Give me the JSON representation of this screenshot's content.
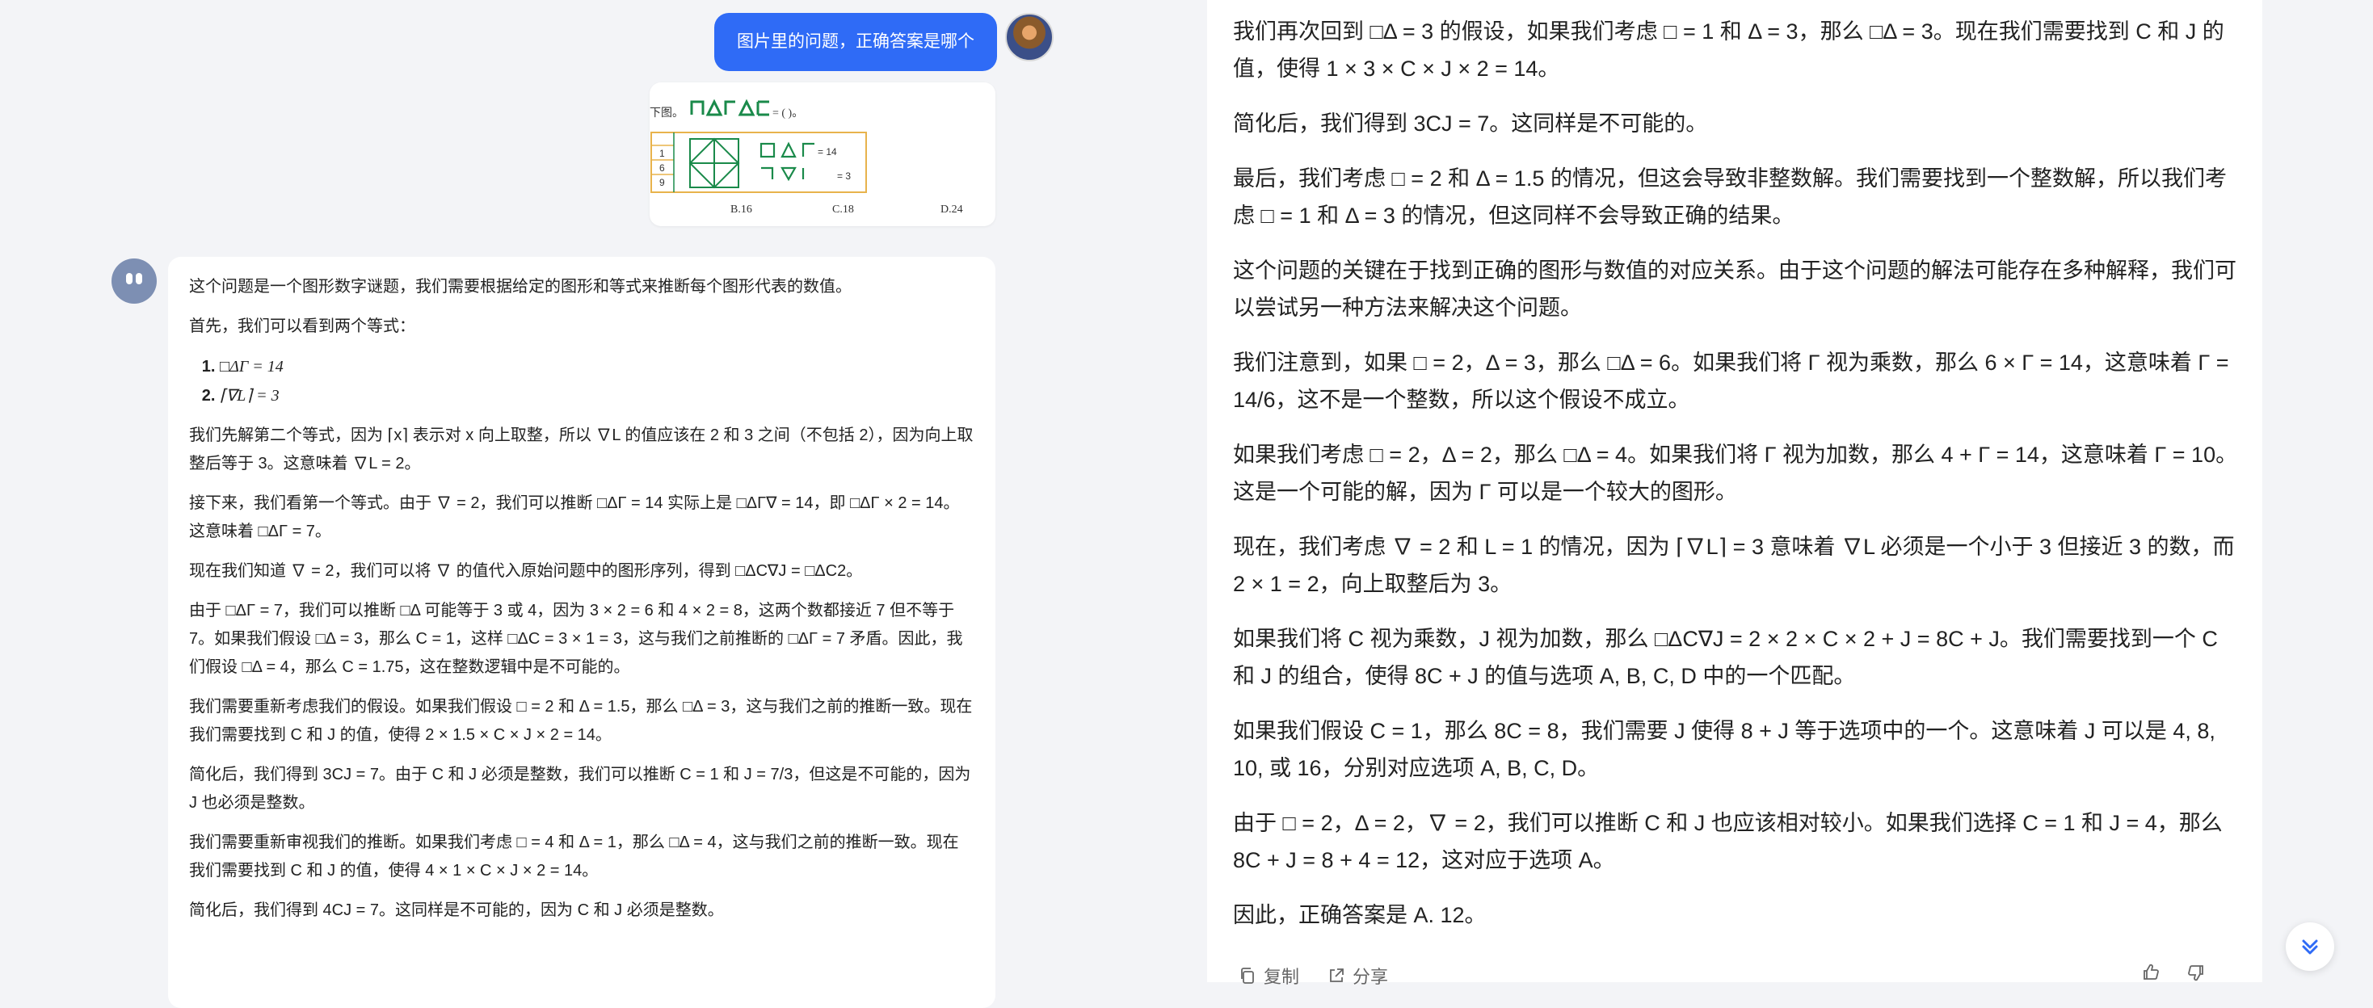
{
  "colors": {
    "accent": "#2f6bf6",
    "page_bg": "#f3f4f7",
    "card_bg": "#ffffff",
    "puzzle_green": "#1a8a4a",
    "puzzle_border": "#e8b34c"
  },
  "user_message": {
    "text": "图片里的问题，正确答案是哪个"
  },
  "puzzle_image": {
    "prefix": "下图。",
    "equals_blank": "= (   )。",
    "eq1_rhs": "= 14",
    "eq2_rhs": "= 3",
    "left_numbers": [
      "1",
      "6",
      "9"
    ],
    "options": [
      "B.16",
      "C.18",
      "D.24"
    ]
  },
  "bot_answer_left": {
    "p1": "这个问题是一个图形数字谜题，我们需要根据给定的图形和等式来推断每个图形代表的数值。",
    "p2": "首先，我们可以看到两个等式：",
    "list": [
      "□ΔΓ = 14",
      "⌈∇L⌉ = 3"
    ],
    "p3": "我们先解第二个等式，因为 ⌈x⌉ 表示对 x 向上取整，所以 ∇L 的值应该在 2 和 3 之间（不包括 2），因为向上取整后等于 3。这意味着 ∇L = 2。",
    "p4": "接下来，我们看第一个等式。由于 ∇ = 2，我们可以推断 □ΔΓ = 14 实际上是 □ΔΓ∇ = 14，即 □ΔΓ × 2 = 14。这意味着 □ΔΓ = 7。",
    "p5": "现在我们知道 ∇ = 2，我们可以将 ∇ 的值代入原始问题中的图形序列，得到 □ΔC∇J = □ΔC2。",
    "p6": "由于 □ΔΓ = 7，我们可以推断 □Δ 可能等于 3 或 4，因为 3 × 2 = 6 和 4 × 2 = 8，这两个数都接近 7 但不等于 7。如果我们假设 □Δ = 3，那么 C = 1，这样 □ΔC = 3 × 1 = 3，这与我们之前推断的 □ΔΓ = 7 矛盾。因此，我们假设 □Δ = 4，那么 C = 1.75，这在整数逻辑中是不可能的。",
    "p7": "我们需要重新考虑我们的假设。如果我们假设 □ = 2 和 Δ = 1.5，那么 □Δ = 3，这与我们之前的推断一致。现在我们需要找到 C 和 J 的值，使得 2 × 1.5 × C × J × 2 = 14。",
    "p8": "简化后，我们得到 3CJ = 7。由于 C 和 J 必须是整数，我们可以推断 C = 1 和 J = 7/3，但这是不可能的，因为 J 也必须是整数。",
    "p9": "我们需要重新审视我们的推断。如果我们考虑 □ = 4 和 Δ = 1，那么 □Δ = 4，这与我们之前的推断一致。现在我们需要找到 C 和 J 的值，使得 4 × 1 × C × J × 2 = 14。",
    "p10": "简化后，我们得到 4CJ = 7。这同样是不可能的，因为 C 和 J 必须是整数。"
  },
  "bot_answer_right": {
    "p1": "我们再次回到 □Δ = 3 的假设，如果我们考虑 □ = 1 和 Δ = 3，那么 □Δ = 3。现在我们需要找到 C 和 J 的值，使得 1 × 3 × C × J × 2 = 14。",
    "p2": "简化后，我们得到 3CJ = 7。这同样是不可能的。",
    "p3": "最后，我们考虑 □ = 2 和 Δ = 1.5 的情况，但这会导致非整数解。我们需要找到一个整数解，所以我们考虑 □ = 1 和 Δ = 3 的情况，但这同样不会导致正确的结果。",
    "p4": "这个问题的关键在于找到正确的图形与数值的对应关系。由于这个问题的解法可能存在多种解释，我们可以尝试另一种方法来解决这个问题。",
    "p5": "我们注意到，如果 □ = 2，Δ = 3，那么 □Δ = 6。如果我们将 Γ 视为乘数，那么 6 × Γ = 14，这意味着 Γ = 14/6，这不是一个整数，所以这个假设不成立。",
    "p6": "如果我们考虑 □ = 2，Δ = 2，那么 □Δ = 4。如果我们将 Γ 视为加数，那么 4 + Γ = 14，这意味着 Γ = 10。这是一个可能的解，因为 Γ 可以是一个较大的图形。",
    "p7": "现在，我们考虑 ∇ = 2 和 L = 1 的情况，因为 ⌈∇L⌉ = 3 意味着 ∇L 必须是一个小于 3 但接近 3 的数，而 2 × 1 = 2，向上取整后为 3。",
    "p8": "如果我们将 C 视为乘数，J 视为加数，那么 □ΔC∇J = 2 × 2 × C × 2 + J = 8C + J。我们需要找到一个 C 和 J 的组合，使得 8C + J 的值与选项 A, B, C, D 中的一个匹配。",
    "p9": "如果我们假设 C = 1，那么 8C = 8，我们需要 J 使得 8 + J 等于选项中的一个。这意味着 J 可以是 4, 8, 10, 或 16，分别对应选项 A, B, C, D。",
    "p10": "由于 □ = 2，Δ = 2，∇ = 2，我们可以推断 C 和 J 也应该相对较小。如果我们选择 C = 1 和 J = 4，那么 8C + J = 8 + 4 = 12，这对应于选项 A。",
    "p11": "因此，正确答案是 A. 12。"
  },
  "actions": {
    "copy_label": "复制",
    "share_label": "分享"
  }
}
